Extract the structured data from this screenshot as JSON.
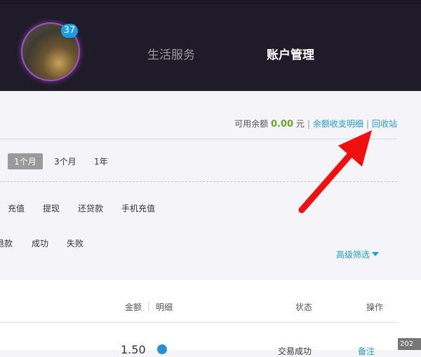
{
  "header": {
    "badge_count": "37",
    "nav": [
      {
        "label": "生活服务"
      },
      {
        "label": "账户管理"
      }
    ]
  },
  "balance": {
    "label": "可用余额",
    "amount": "0.00",
    "unit": "元",
    "detail_link": "余额收支明细",
    "recycle_link": "回收站"
  },
  "periods": [
    "1个月",
    "3个月",
    "1年"
  ],
  "types": [
    "充值",
    "提现",
    "还贷款",
    "手机充值"
  ],
  "statuses": [
    "退款",
    "成功",
    "失败"
  ],
  "advanced_filter": "高级筛选",
  "table": {
    "headers": {
      "amount": "金额",
      "detail": "明细",
      "status": "状态",
      "action": "操作"
    },
    "rows": [
      {
        "amount": "1.50",
        "status": "交易成功",
        "action": "备注"
      }
    ]
  },
  "corner_label": "202"
}
